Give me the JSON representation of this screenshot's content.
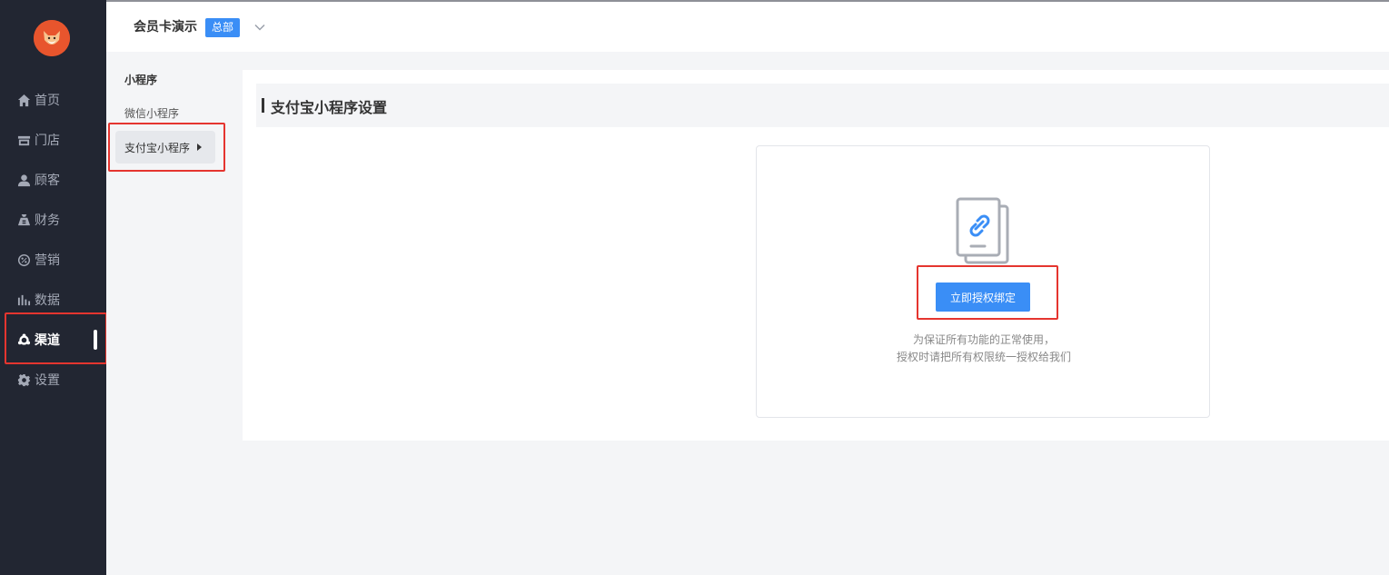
{
  "header": {
    "store_name": "会员卡演示",
    "store_badge": "总部"
  },
  "nav": {
    "items": [
      {
        "label": "首页",
        "icon": "home-icon"
      },
      {
        "label": "门店",
        "icon": "store-icon"
      },
      {
        "label": "顾客",
        "icon": "user-icon"
      },
      {
        "label": "财务",
        "icon": "money-bag-icon"
      },
      {
        "label": "营销",
        "icon": "discount-icon"
      },
      {
        "label": "数据",
        "icon": "bar-chart-icon"
      },
      {
        "label": "渠道",
        "icon": "channel-icon",
        "active": true
      },
      {
        "label": "设置",
        "icon": "gear-icon"
      }
    ]
  },
  "submenu": {
    "title": "小程序",
    "items": [
      {
        "label": "微信小程序"
      },
      {
        "label": "支付宝小程序",
        "active": true
      }
    ]
  },
  "main": {
    "section_title": "支付宝小程序设置",
    "auth": {
      "icon": "link-document-icon",
      "button_label": "立即授权绑定",
      "hint_line1": "为保证所有功能的正常使用，",
      "hint_line2": "授权时请把所有权限统一授权给我们"
    }
  },
  "colors": {
    "nav_bg": "#222632",
    "accent": "#3a8ef6",
    "highlight_box": "#e5352f",
    "logo": "#e8552d"
  }
}
